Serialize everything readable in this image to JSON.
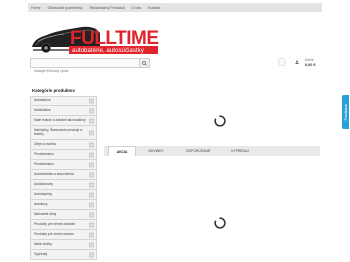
{
  "topnav": {
    "items": [
      "Home",
      "Obchodné podmienky",
      "Reklamačný Poriadok",
      "O nás",
      "Kontakt"
    ]
  },
  "logo": {
    "name": "FULLTIME",
    "tagline": "autobatérie, autosúčiastky",
    "colors": {
      "brand_red": "#e0242b",
      "dark": "#1a1a1a"
    }
  },
  "search": {
    "placeholder": "Zadajte Kľúčový výraz",
    "icon": "search-icon"
  },
  "header": {
    "wishlist_icon": "heart-icon",
    "account_icon": "user-icon",
    "cart_label": "Košík",
    "cart_total": "0,00 €"
  },
  "sidebar": {
    "title": "Kategórie produktov",
    "items": [
      "Autokabíne",
      "Mobilabílne",
      "Malé trakcie a záložné akumulátory",
      "Nabíjačky, Štartovacie prístroje a testery",
      "Oleje a maziva",
      "Príslušenstvo",
      "Príslušenstvo",
      "Autoelektrika a autochémia",
      "Autožiarovky",
      "Autodoplnky",
      "Autokozy",
      "Náhradné diely",
      "Produkty pre zimné obdobie",
      "Produkty pre zimnú sezónu",
      "Naše služby",
      "Výpredaj"
    ]
  },
  "tabs": [
    {
      "label": "AKCIA",
      "active": true
    },
    {
      "label": "NOVINKY",
      "active": false
    },
    {
      "label": "ODPORÚČANÉ",
      "active": false
    },
    {
      "label": "VÝPREDAJ",
      "active": false
    }
  ],
  "feedback": {
    "label": "Feedback"
  },
  "colors": {
    "accent": "#2aa0d8",
    "nav_bg": "#e4e4e4",
    "tab_bg": "#e9e9e9"
  }
}
